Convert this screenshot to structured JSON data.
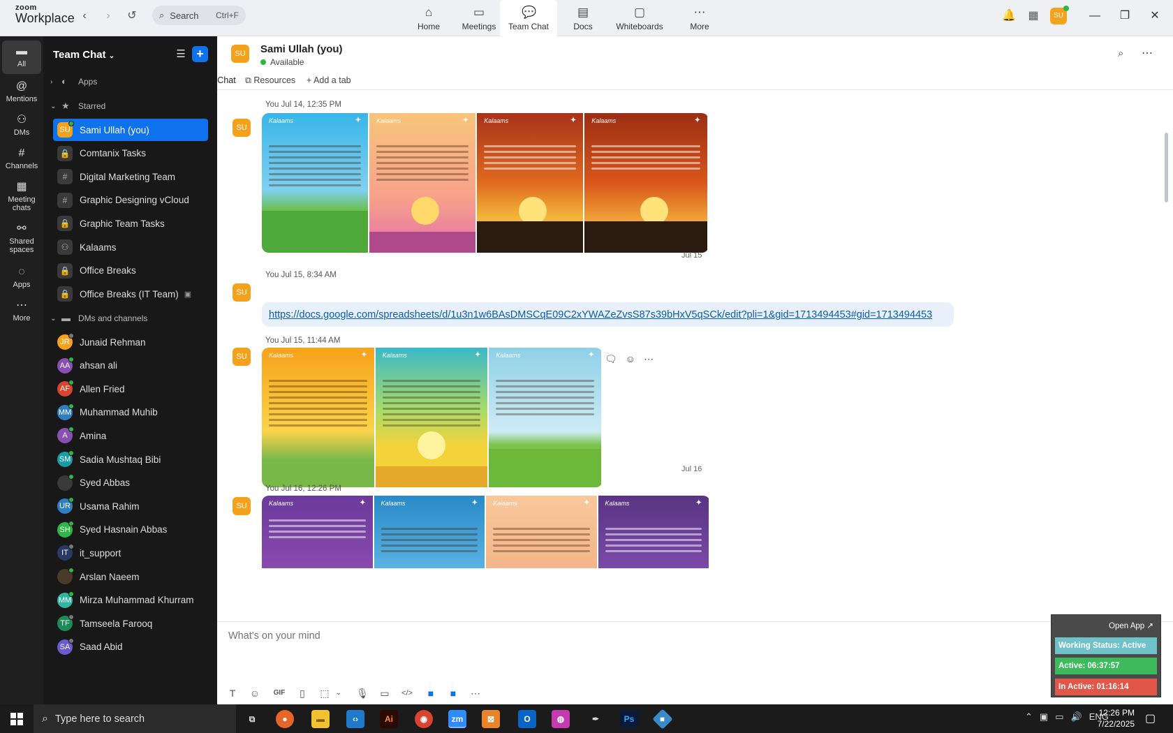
{
  "app": {
    "brand_top": "zoom",
    "brand_bottom": "Workplace"
  },
  "search": {
    "placeholder": "Search",
    "shortcut": "Ctrl+F"
  },
  "nav_tabs": [
    {
      "label": "Home",
      "icon": "home-icon"
    },
    {
      "label": "Meetings",
      "icon": "video-icon"
    },
    {
      "label": "Team Chat",
      "icon": "chat-icon"
    },
    {
      "label": "Docs",
      "icon": "doc-icon"
    },
    {
      "label": "Whiteboards",
      "icon": "whiteboard-icon"
    },
    {
      "label": "More",
      "icon": "more-icon"
    }
  ],
  "user_avatar": "SU",
  "rail": [
    {
      "label": "All",
      "icon": "chat-bubble-icon"
    },
    {
      "label": "Mentions",
      "icon": "at-icon"
    },
    {
      "label": "DMs",
      "icon": "people-icon"
    },
    {
      "label": "Channels",
      "icon": "hash-icon"
    },
    {
      "label": "Meeting chats",
      "icon": "calendar-icon"
    },
    {
      "label": "Shared spaces",
      "icon": "shared-icon"
    },
    {
      "label": "Apps",
      "icon": "apps-icon"
    },
    {
      "label": "More",
      "icon": "more-icon"
    }
  ],
  "sidebar": {
    "title": "Team Chat",
    "sections": {
      "apps": "Apps",
      "starred": "Starred",
      "dms": "DMs and channels"
    },
    "starred": [
      {
        "label": "Sami Ullah (you)",
        "initials": "SU",
        "color": "#f4a21c",
        "kind": "user",
        "presence": "#2db744"
      },
      {
        "label": "Comtanix Tasks",
        "kind": "lock"
      },
      {
        "label": "Digital Marketing Team",
        "kind": "hash"
      },
      {
        "label": "Graphic Designing vCloud",
        "kind": "hash"
      },
      {
        "label": "Graphic Team Tasks",
        "kind": "lock"
      },
      {
        "label": "Kalaams",
        "kind": "group"
      },
      {
        "label": "Office Breaks",
        "kind": "lock"
      },
      {
        "label": "Office Breaks (IT Team)",
        "kind": "lock"
      }
    ],
    "dms": [
      {
        "label": "Junaid Rehman",
        "initials": "JR",
        "color": "#f4a21c",
        "presence": "#777"
      },
      {
        "label": "ahsan ali",
        "initials": "AA",
        "color": "#8a4fb3",
        "presence": "#2db744"
      },
      {
        "label": "Allen Fried",
        "initials": "AF",
        "color": "#d9442e",
        "presence": "#2db744"
      },
      {
        "label": "Muhammad Muhib",
        "initials": "MM",
        "color": "#2e7fc1",
        "presence": "#2db744"
      },
      {
        "label": "Amina",
        "initials": "A",
        "color": "#8a4fb3",
        "presence": "#2db744"
      },
      {
        "label": "Sadia Mushtaq Bibi",
        "initials": "SM",
        "color": "#1b9aa8",
        "presence": "#2db744"
      },
      {
        "label": "Syed Abbas",
        "initials": "",
        "color": "#3a3a3a",
        "presence": "#2db744"
      },
      {
        "label": "Usama Rahim",
        "initials": "UR",
        "color": "#2e7fc1",
        "presence": "#2db744"
      },
      {
        "label": "Syed Hasnain Abbas",
        "initials": "SH",
        "color": "#2db744",
        "presence": "#2db744"
      },
      {
        "label": "it_support",
        "initials": "IT",
        "color": "#2a3a66",
        "presence": "#777"
      },
      {
        "label": "Arslan Naeem",
        "initials": "",
        "color": "#4a3a2a",
        "presence": "#2db744"
      },
      {
        "label": "Mirza Muhammad Khurram",
        "initials": "MM",
        "color": "#2db7a0",
        "presence": "#2db744"
      },
      {
        "label": "Tamseela Farooq",
        "initials": "TF",
        "color": "#1e8a5a",
        "presence": "#777"
      },
      {
        "label": "Saad Abid",
        "initials": "SA",
        "color": "#6a5acd",
        "presence": "#777"
      }
    ]
  },
  "chat": {
    "name": "Sami Ullah (you)",
    "avatar": "SU",
    "status": "Available",
    "tabs": [
      "Chat",
      "Resources",
      "+ Add a tab"
    ]
  },
  "messages": [
    {
      "meta": "You Jul 14, 12:35 PM",
      "kind": "images"
    },
    {
      "divider": "Jul 15"
    },
    {
      "meta": "You Jul 15, 8:34 AM",
      "kind": "link",
      "link": "https://docs.google.com/spreadsheets/d/1u3n1w6BAsDMSCqE09C2xYWAZeZvsS87s39bHxV5qSCk/edit?pli=1&gid=1713494453#gid=1713494453"
    },
    {
      "meta": "You Jul 15, 11:44 AM",
      "kind": "images"
    },
    {
      "divider": "Jul 16"
    },
    {
      "meta": "You Jul 16, 12:26 PM",
      "kind": "images"
    }
  ],
  "composer": {
    "placeholder": "What's on your mind"
  },
  "status_widget": {
    "open_app": "Open App ↗",
    "working": "Working Status: Active",
    "active": "Active: 06:37:57",
    "inactive": "In Active: 01:16:14",
    "colors": {
      "working": "#6fc2c8",
      "active": "#3dbb5c",
      "inactive": "#e0574a"
    }
  },
  "taskbar": {
    "search_placeholder": "Type here to search",
    "time": "12:26 PM",
    "date": "7/22/2025"
  }
}
